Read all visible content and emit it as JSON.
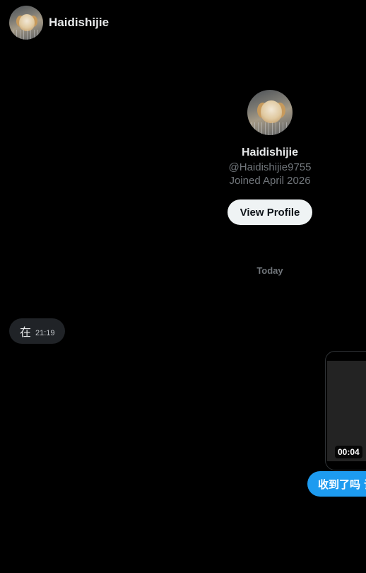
{
  "header": {
    "name": "Haidishijie",
    "avatar_icon": "dog-avatar"
  },
  "profile": {
    "name": "Haidishijie",
    "handle": "@Haidishijie9755",
    "joined": "Joined April 2026",
    "view_profile_label": "View Profile"
  },
  "date_separator": "Today",
  "messages": [
    {
      "direction": "received",
      "text": "在",
      "time": "21:19"
    },
    {
      "direction": "sent",
      "type": "video",
      "duration": "00:04"
    },
    {
      "direction": "sent",
      "text": "收到了吗 请"
    }
  ],
  "colors": {
    "background": "#000000",
    "sent_bubble": "#1d9bf0",
    "received_bubble": "#202327",
    "muted_text": "#71767b"
  }
}
